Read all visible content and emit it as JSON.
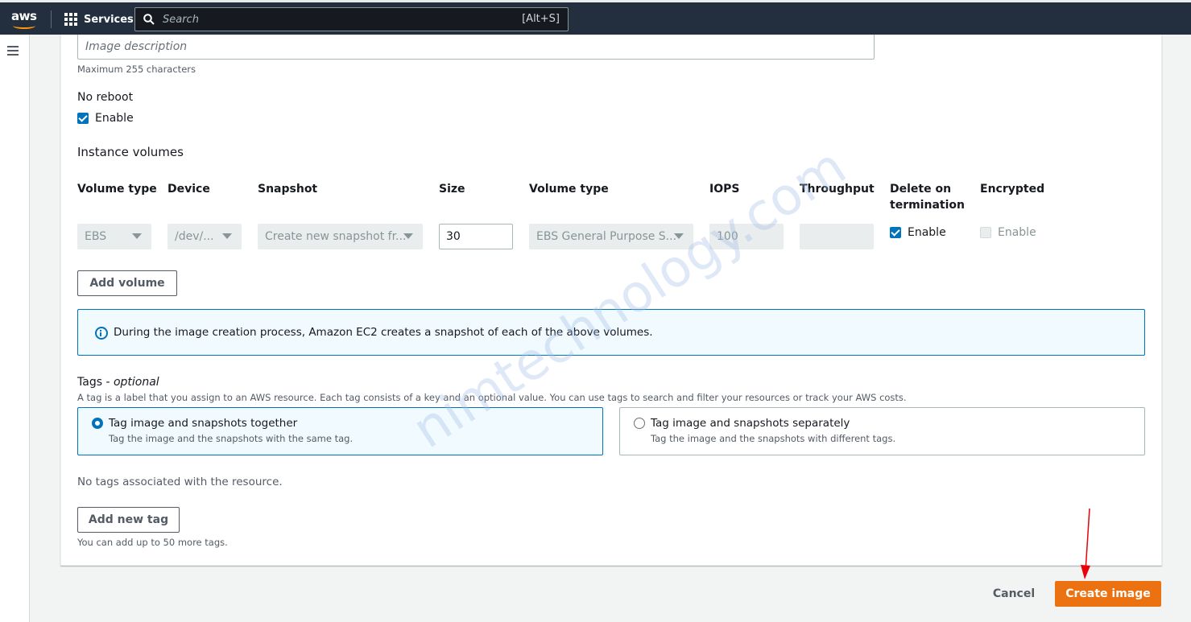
{
  "topnav": {
    "logo": "aws",
    "services_label": "Services",
    "search_placeholder": "Search",
    "search_shortcut": "[Alt+S]"
  },
  "form": {
    "description_placeholder": "Image description",
    "description_hint": "Maximum 255 characters",
    "no_reboot_label": "No reboot",
    "no_reboot_enable_label": "Enable",
    "no_reboot_checked": true,
    "instance_volumes_title": "Instance volumes",
    "columns": [
      "Volume type",
      "Device",
      "Snapshot",
      "Size",
      "Volume type",
      "IOPS",
      "Throughput",
      "Delete on termination",
      "Encrypted"
    ],
    "volume_row": {
      "volume_type": "EBS",
      "device": "/dev/...",
      "snapshot": "Create new snapshot fr...",
      "size": "30",
      "ebs_volume_type": "EBS General Purpose S...",
      "iops": "100",
      "throughput": "",
      "delete_on_termination_label": "Enable",
      "delete_on_termination_checked": true,
      "encrypted_label": "Enable",
      "encrypted_checked": false
    },
    "add_volume_label": "Add volume",
    "info_text": "During the image creation process, Amazon EC2 creates a snapshot of each of the above volumes.",
    "tags_title": "Tags -",
    "tags_optional": "optional",
    "tags_description": "A tag is a label that you assign to an AWS resource. Each tag consists of a key and an optional value. You can use tags to search and filter your resources or track your AWS costs.",
    "tag_options": [
      {
        "title": "Tag image and snapshots together",
        "description": "Tag the image and the snapshots with the same tag.",
        "selected": true
      },
      {
        "title": "Tag image and snapshots separately",
        "description": "Tag the image and the snapshots with different tags.",
        "selected": false
      }
    ],
    "no_tags_text": "No tags associated with the resource.",
    "add_tag_label": "Add new tag",
    "tags_hint": "You can add up to 50 more tags."
  },
  "footer": {
    "cancel_label": "Cancel",
    "create_label": "Create image"
  },
  "watermark": "nimtechnology.com",
  "colors": {
    "nav_bg": "#232f3e",
    "primary_orange": "#ec7211",
    "link_blue": "#0073bb",
    "annotation_arrow": "#e8000b"
  }
}
